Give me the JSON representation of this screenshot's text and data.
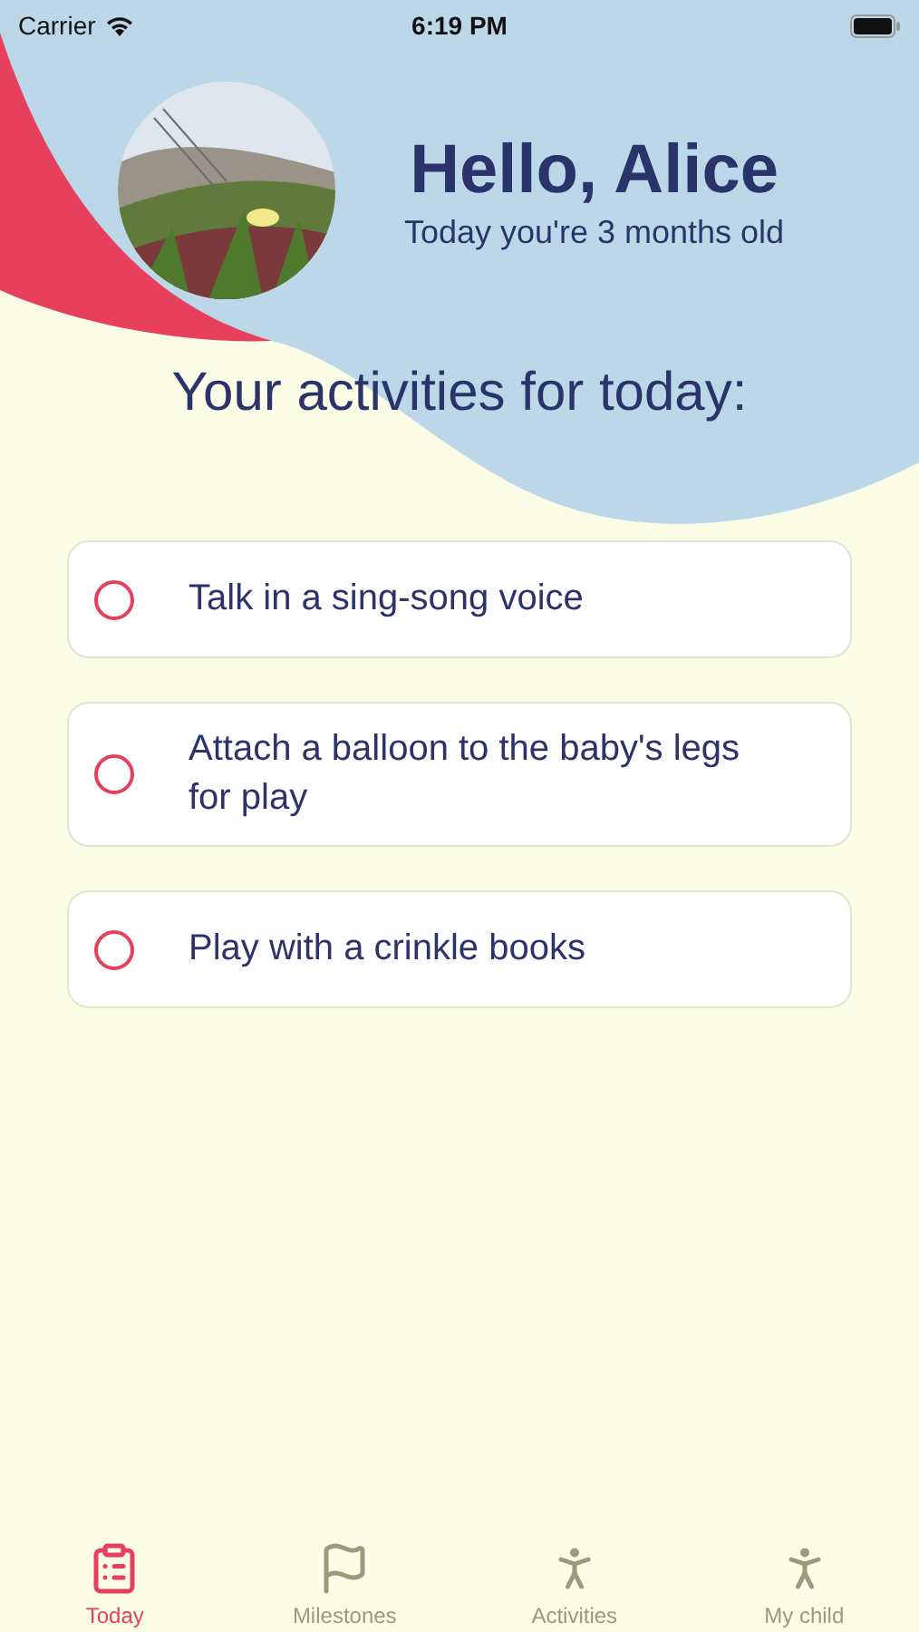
{
  "status_bar": {
    "carrier": "Carrier",
    "time": "6:19 PM"
  },
  "header": {
    "title": "Hello, Alice",
    "subtitle": "Today you're 3 months old"
  },
  "section_title": "Your activities for today:",
  "activities": [
    {
      "label": "Talk in a sing-song voice",
      "checked": false
    },
    {
      "label": "Attach a balloon to the baby's legs for play",
      "checked": false
    },
    {
      "label": "Play with a crinkle books",
      "checked": false
    }
  ],
  "tabs": [
    {
      "label": "Today",
      "selected": true
    },
    {
      "label": "Milestones",
      "selected": false
    },
    {
      "label": "Activities",
      "selected": false
    },
    {
      "label": "My child",
      "selected": false
    }
  ]
}
